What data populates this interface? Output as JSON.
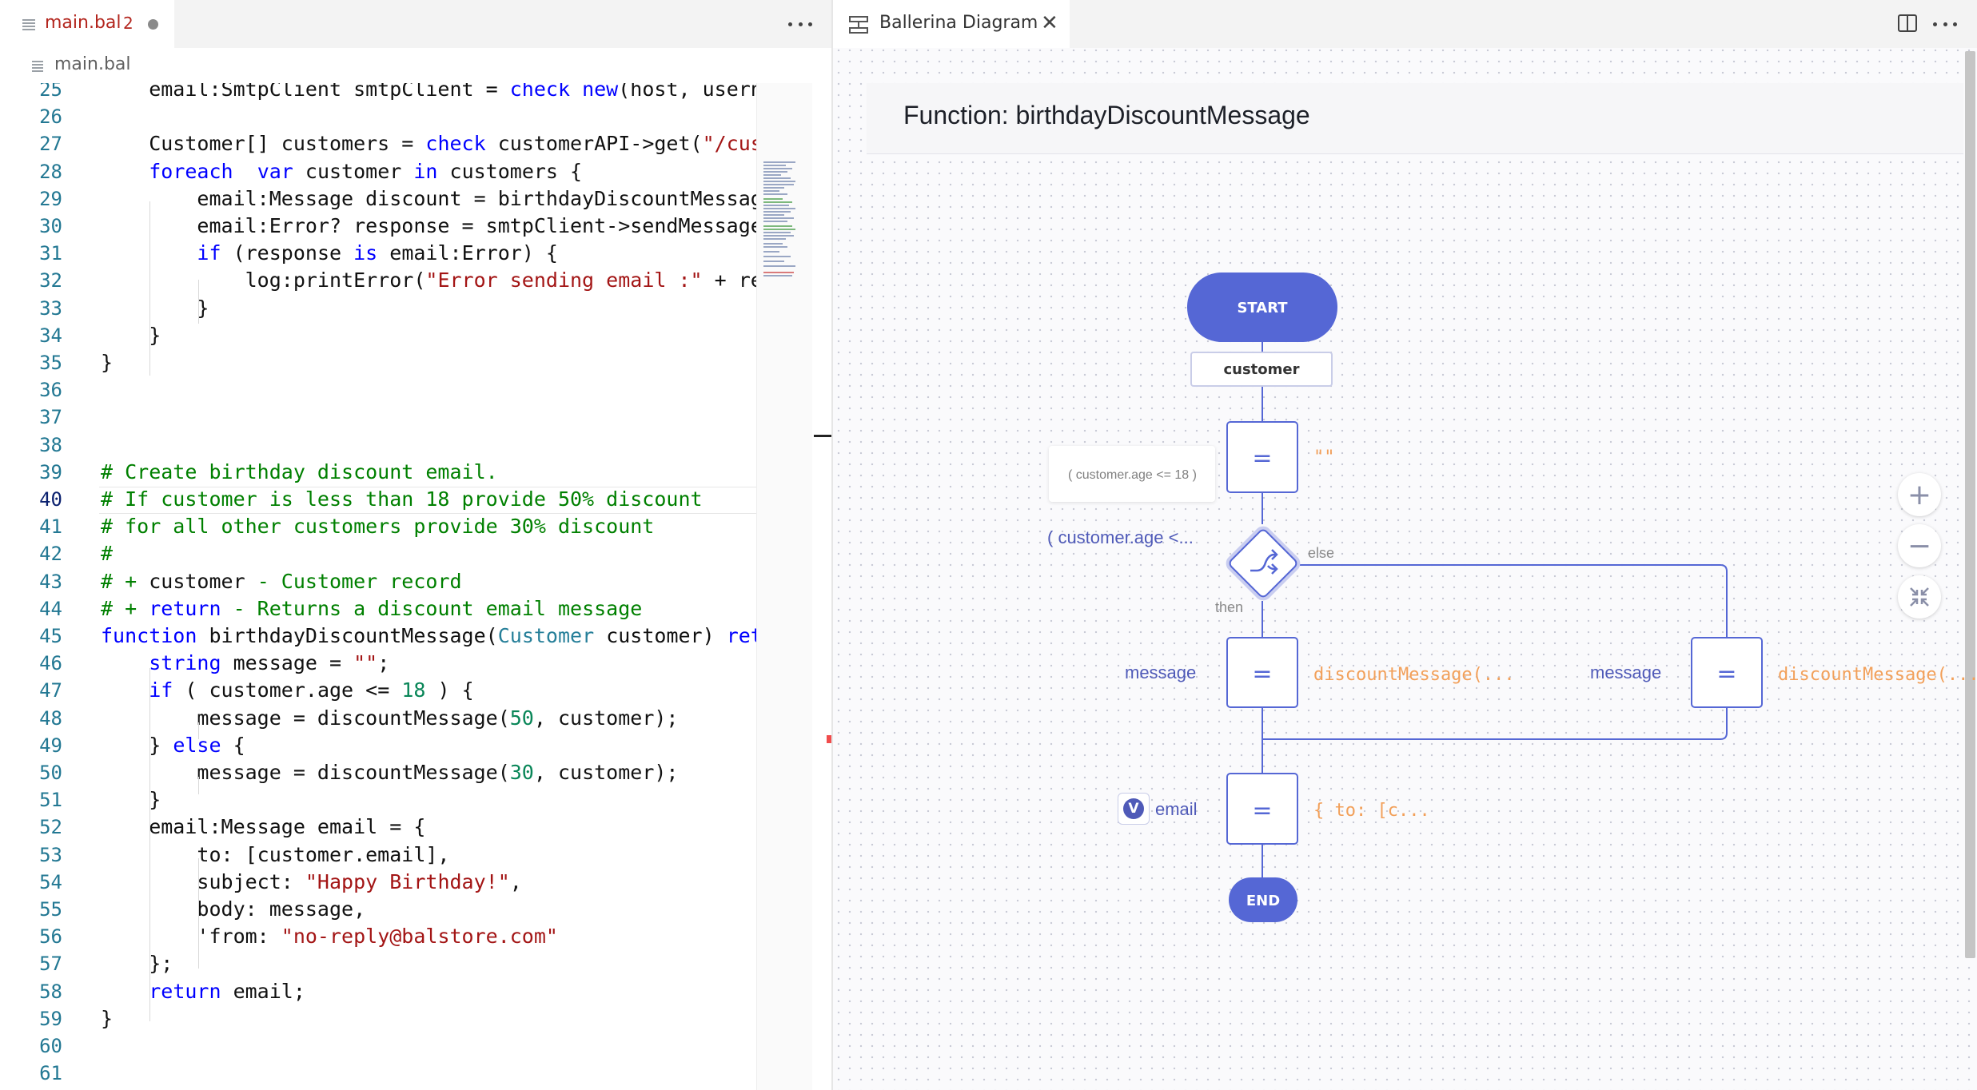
{
  "editor": {
    "tab": {
      "label": "main.bal",
      "count": "2"
    },
    "breadcrumb": "main.bal",
    "lines": [
      {
        "n": "25",
        "html": "    email:SmtpClient smtpClient = <span class=\"kw\">check</span> <span class=\"kw\">new</span>(host, usern"
      },
      {
        "n": "26",
        "html": ""
      },
      {
        "n": "27",
        "html": "    Customer[] customers = <span class=\"kw\">check</span> customerAPI-&gt;get(<span class=\"str\">\"/cus</span>"
      },
      {
        "n": "28",
        "html": "    <span class=\"kw\">foreach</span>  <span class=\"kw\">var</span> customer <span class=\"kw\">in</span> customers {"
      },
      {
        "n": "29",
        "html": "        email:Message discount = birthdayDiscountMessag"
      },
      {
        "n": "30",
        "html": "        email:Error? response = smtpClient-&gt;sendMessage"
      },
      {
        "n": "31",
        "html": "        <span class=\"kw\">if</span> (response <span class=\"kw\">is</span> email:Error) {"
      },
      {
        "n": "32",
        "html": "            log:printError(<span class=\"str\">\"Error sending email :\"</span> + re"
      },
      {
        "n": "33",
        "html": "        }"
      },
      {
        "n": "34",
        "html": "    }"
      },
      {
        "n": "35",
        "html": "}"
      },
      {
        "n": "36",
        "html": ""
      },
      {
        "n": "37",
        "html": ""
      },
      {
        "n": "38",
        "html": ""
      },
      {
        "n": "39",
        "html": "<span class=\"cm\"># Create birthday discount email.</span>"
      },
      {
        "n": "40",
        "html": "<span class=\"cm\"># If customer is less than 18 provide 50% discount</span>"
      },
      {
        "n": "41",
        "html": "<span class=\"cm\"># for all other customers provide 30% discount</span>"
      },
      {
        "n": "42",
        "html": "<span class=\"cm\">#</span>"
      },
      {
        "n": "43",
        "html": "<span class=\"cm\"># + </span>customer <span class=\"cm\">- Customer record</span>"
      },
      {
        "n": "44",
        "html": "<span class=\"cm\"># + </span><span class=\"kw\">return</span><span class=\"cm\"> - Returns a discount email message</span>"
      },
      {
        "n": "45",
        "html": "<span class=\"kw\">function</span> birthdayDiscountMessage(<span class=\"ty\">Customer</span> customer) <span class=\"kw\">ret</span>"
      },
      {
        "n": "46",
        "html": "    <span class=\"kw\">string</span> message = <span class=\"str\">\"\"</span>;"
      },
      {
        "n": "47",
        "html": "    <span class=\"kw\">if</span> ( customer.age &lt;= <span class=\"num\">18</span> ) {"
      },
      {
        "n": "48",
        "html": "        message = discountMessage(<span class=\"num\">50</span>, customer);"
      },
      {
        "n": "49",
        "html": "    } <span class=\"kw\">else</span> {"
      },
      {
        "n": "50",
        "html": "        message = discountMessage(<span class=\"num\">30</span>, customer);"
      },
      {
        "n": "51",
        "html": "    }"
      },
      {
        "n": "52",
        "html": "    email:Message email = {"
      },
      {
        "n": "53",
        "html": "        to: [customer.email],"
      },
      {
        "n": "54",
        "html": "        subject: <span class=\"str\">\"Happy Birthday!\"</span>,"
      },
      {
        "n": "55",
        "html": "        body: message,"
      },
      {
        "n": "56",
        "html": "        'from: <span class=\"str\">\"no-reply@balstore.com\"</span>"
      },
      {
        "n": "57",
        "html": "    };"
      },
      {
        "n": "58",
        "html": "    <span class=\"kw\">return</span> email;"
      },
      {
        "n": "59",
        "html": "}"
      },
      {
        "n": "60",
        "html": ""
      },
      {
        "n": "61",
        "html": ""
      }
    ],
    "current_line": "40"
  },
  "diagram": {
    "tab_label": "Ballerina Diagram",
    "function_title": "Function: birthdayDiscountMessage",
    "start_label": "START",
    "end_label": "END",
    "param_label": "customer",
    "assign_symbol": "=",
    "empty_string_value": "\"\"",
    "condition_tooltip": "( customer.age <= 18 )",
    "condition_label": "( customer.age <...",
    "else_label": "else",
    "then_label": "then",
    "then_var": "message",
    "then_value": "discountMessage(...",
    "else_var": "message",
    "else_value": "discountMessage(...",
    "email_var": "email",
    "email_value": "{ to: [c...",
    "var_badge": "V",
    "zoom_in": "+",
    "zoom_out": "−",
    "accent_color": "#5567d5"
  }
}
